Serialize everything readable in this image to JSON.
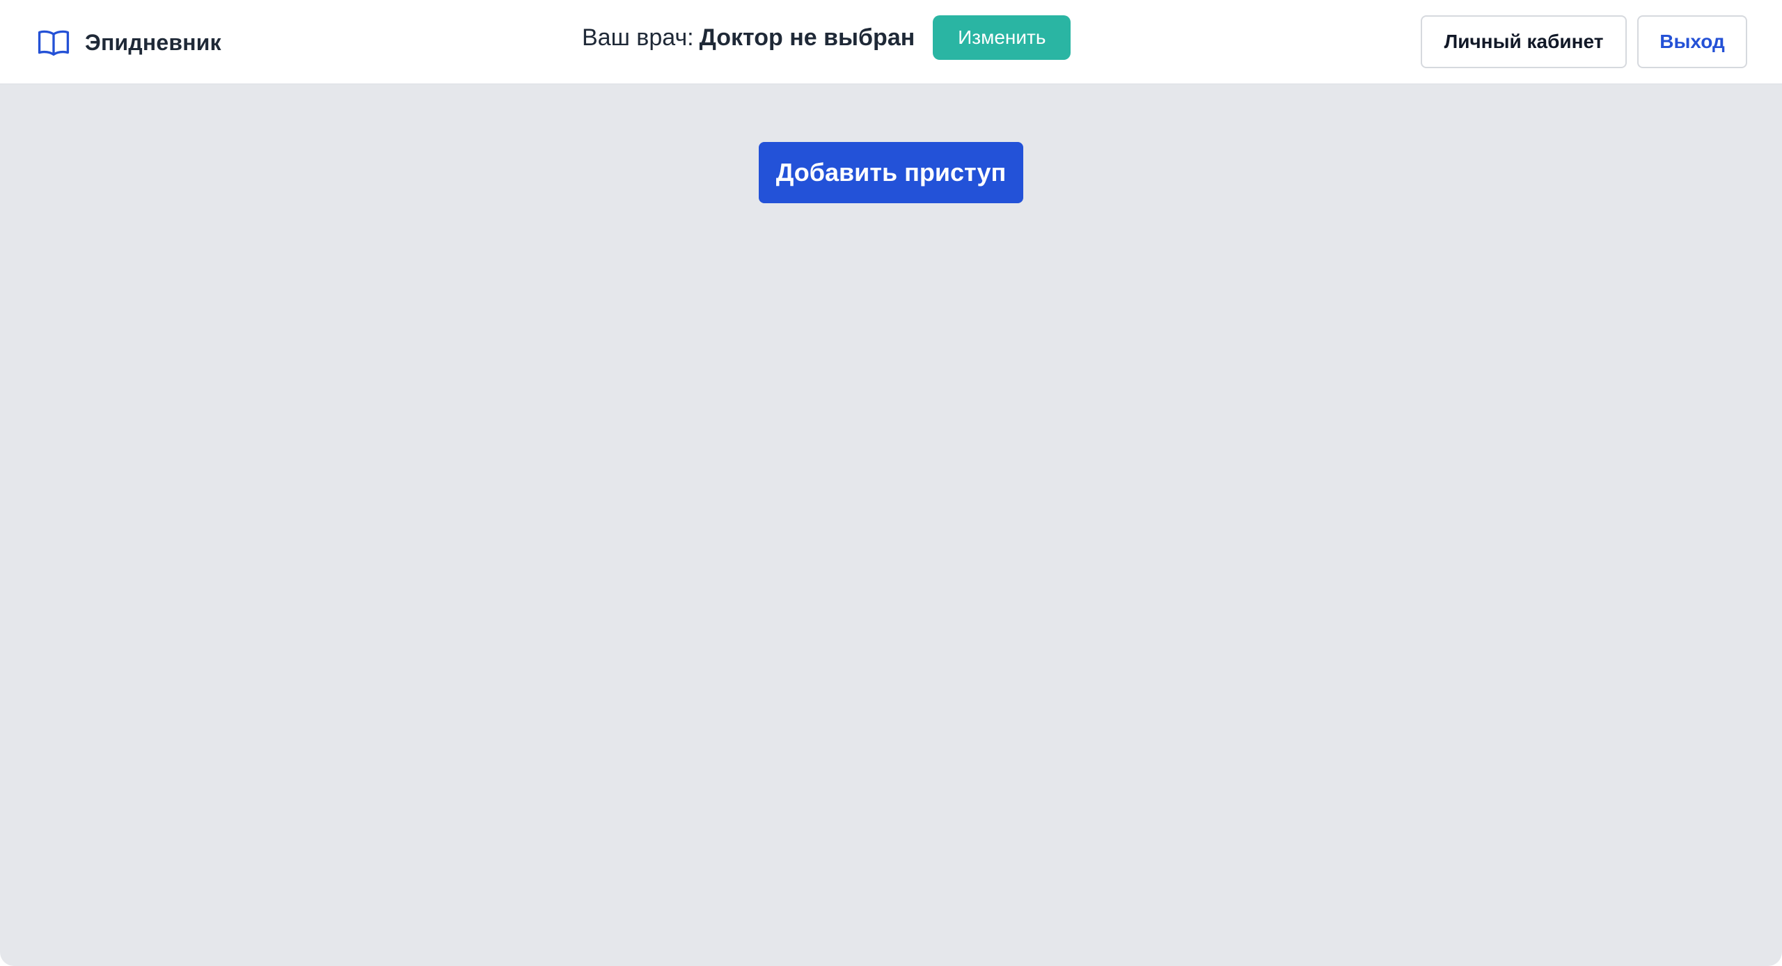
{
  "header": {
    "brand": {
      "icon": "open-book-icon",
      "name": "Эпидневник"
    },
    "doctor": {
      "label": "Ваш врач:",
      "name": "Доктор не выбран",
      "change_label": "Изменить"
    },
    "cabinet_label": "Личный кабинет",
    "logout_label": "Выход"
  },
  "main": {
    "add_seizure_label": "Добавить приступ"
  },
  "colors": {
    "brand_icon": "#2451d6",
    "change_button": "#2ab5a3",
    "primary_button": "#2352d8",
    "logout_text": "#2451d6",
    "background": "#e5e7eb"
  }
}
